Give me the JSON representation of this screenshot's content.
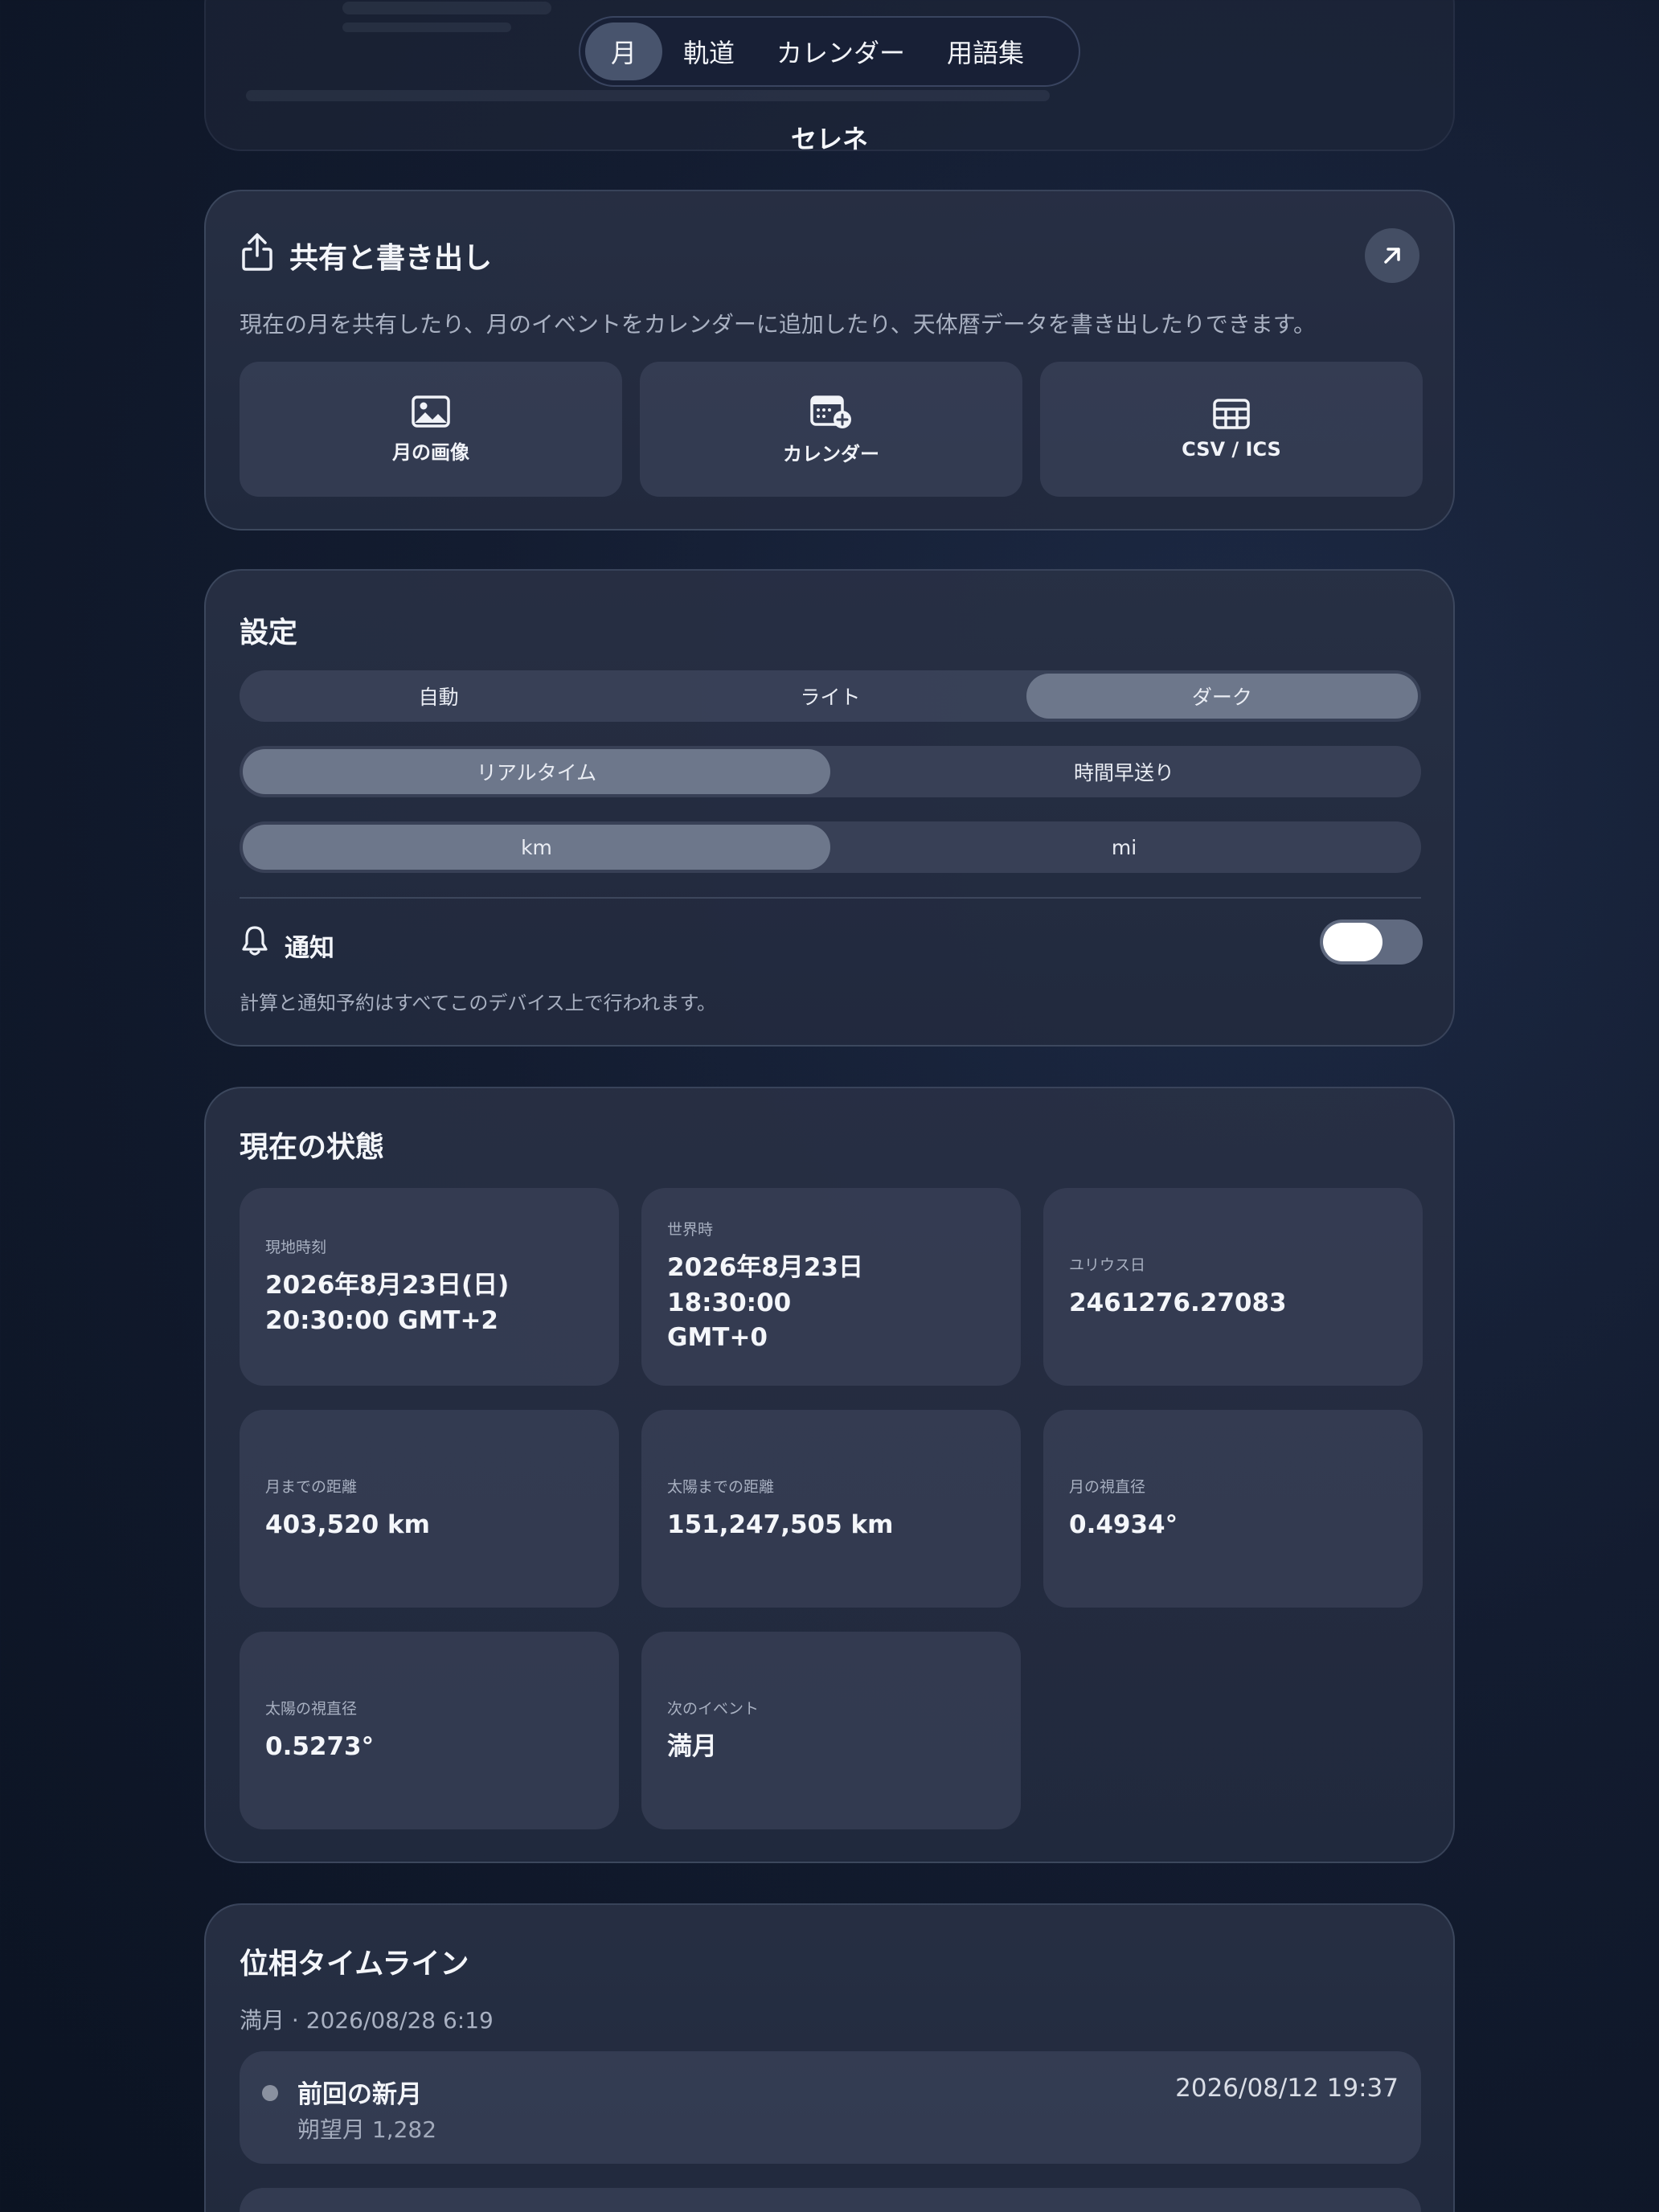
{
  "nav": {
    "tabs": [
      "月",
      "軌道",
      "カレンダー",
      "用語集"
    ],
    "active_index": 0
  },
  "app_title": "セレネ",
  "share": {
    "title": "共有と書き出し",
    "description": "現在の月を共有したり、月のイベントをカレンダーに追加したり、天体暦データを書き出したりできます。",
    "actions": [
      {
        "label": "月の画像",
        "icon": "image-icon"
      },
      {
        "label": "カレンダー",
        "icon": "calendar-add-icon"
      },
      {
        "label": "CSV / ICS",
        "icon": "table-icon"
      }
    ],
    "corner_icon": "arrow-up-right-icon"
  },
  "settings": {
    "title": "設定",
    "theme": {
      "options": [
        "自動",
        "ライト",
        "ダーク"
      ],
      "selected": "ダーク"
    },
    "time_mode": {
      "options": [
        "リアルタイム",
        "時間早送り"
      ],
      "selected": "リアルタイム"
    },
    "units": {
      "options": [
        "km",
        "mi"
      ],
      "selected": "km"
    },
    "notifications": {
      "label": "通知",
      "enabled": false,
      "icon": "bell-icon"
    },
    "note": "計算と通知予約はすべてこのデバイス上で行われます。"
  },
  "status": {
    "title": "現在の状態",
    "items": [
      {
        "label": "現地時刻",
        "value": "2026年8月23日(日)\n20:30:00 GMT+2"
      },
      {
        "label": "世界時",
        "value": "2026年8月23日 18:30:00\nGMT+0"
      },
      {
        "label": "ユリウス日",
        "value": "2461276.27083"
      },
      {
        "label": "月までの距離",
        "value": "403,520 km"
      },
      {
        "label": "太陽までの距離",
        "value": "151,247,505 km"
      },
      {
        "label": "月の視直径",
        "value": "0.4934°"
      },
      {
        "label": "太陽の視直径",
        "value": "0.5273°"
      },
      {
        "label": "次のイベント",
        "value": "満月"
      }
    ]
  },
  "timeline": {
    "title": "位相タイムライン",
    "subtitle": "満月 · 2026/08/28 6:19",
    "rows": [
      {
        "name": "前回の新月",
        "meta": "朔望月 1,282",
        "date": "2026/08/12 19:37"
      }
    ]
  }
}
